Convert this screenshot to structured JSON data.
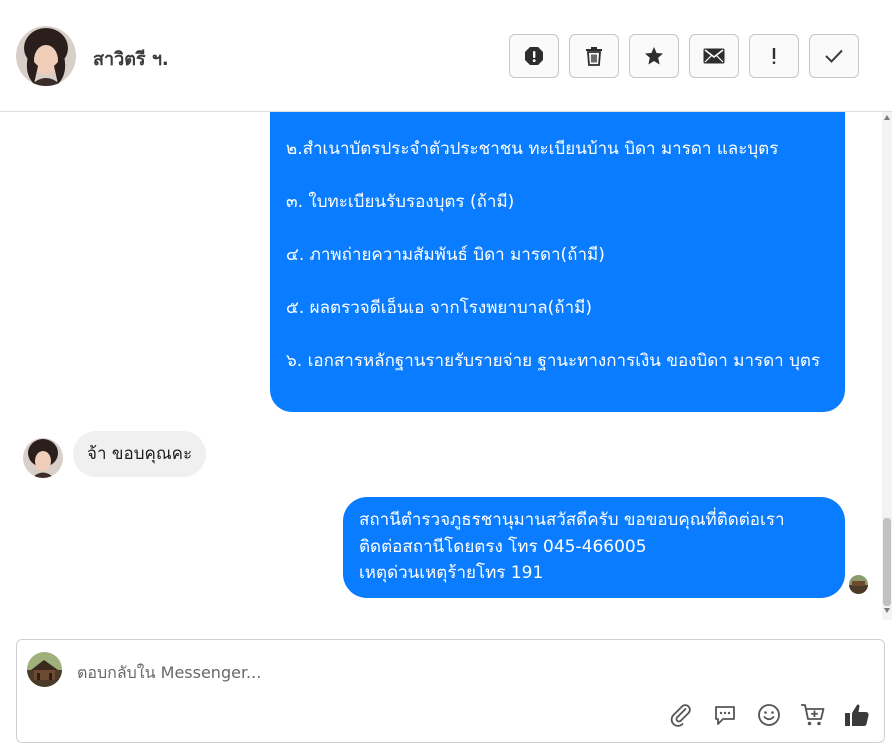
{
  "header": {
    "contact_name": "สาวิตรี ฯ.",
    "actions": [
      "report-spam",
      "delete",
      "star",
      "mark-unread",
      "important",
      "done"
    ]
  },
  "messages": {
    "long_outgoing": [
      "๒.สำเนาบัตรประจำตัวประชาชน ทะเบียนบ้าน บิดา มารดา และบุตร",
      "๓. ใบทะเบียนรับรองบุตร (ถ้ามี)",
      "๔. ภาพถ่ายความสัมพันธ์ บิดา มารดา(ถ้ามี)",
      "๕. ผลตรวจดีเอ็นเอ จากโรงพยาบาล(ถ้ามี)",
      "๖. เอกสารหลักฐานรายรับรายจ่าย ฐานะทางการเงิน ของบิดา มารดา บุตร"
    ],
    "incoming": "จ้า ขอบคุณคะ",
    "reply_lines": [
      "สถานีตำรวจภูธรชานุมานสวัสดีครับ ขอขอบคุณที่ติดต่อเรา",
      "ติดต่อสถานีโดยตรง โทร 045-466005",
      "เหตุด่วนเหตุร้ายโทร 191"
    ]
  },
  "composer": {
    "placeholder": "ตอบกลับใน Messenger..."
  },
  "colors": {
    "outgoing_bubble": "#0a7cff",
    "incoming_bubble": "#f0f0f0"
  }
}
